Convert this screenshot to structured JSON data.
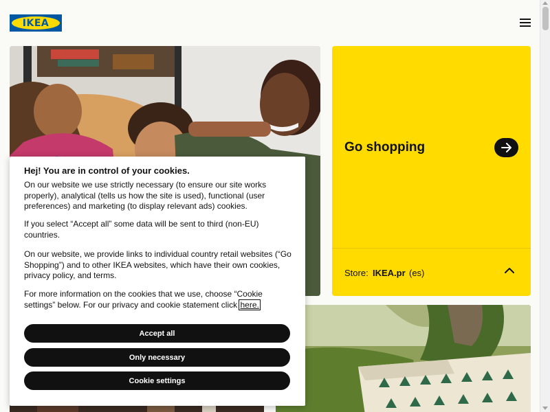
{
  "header": {
    "logo_text": "IKEA",
    "menu_icon": "hamburger-menu-icon"
  },
  "colors": {
    "brand_blue": "#0058a3",
    "brand_yellow": "#ffdb00",
    "button_black": "#111111"
  },
  "shop_card": {
    "title": "Go shopping",
    "arrow_icon": "arrow-right-icon",
    "store_prefix": "Store:",
    "store_name": "IKEA.pr",
    "store_lang": "(es)",
    "chevron_icon": "chevron-up-icon"
  },
  "cookie_dialog": {
    "title": "Hej! You are in control of your cookies.",
    "paragraph_1": "On our website we use strictly necessary (to ensure our site works properly), analytical (tells us how the site is used), functional (user preferences) and marketing (to display relevant ads) cookies.",
    "paragraph_2": "If you select “Accept all” some data will be sent to third (non-EU) countries.",
    "paragraph_3": "On our website, we provide links to individual country retail websites (“Go Shopping”) and to other IKEA websites, which have their own cookies, privacy policy, and terms.",
    "paragraph_4": "For more information on the cookies that we use, choose “Cookie settings” below. For our privacy and cookie statement click",
    "link_here": "here.",
    "buttons": {
      "accept_all": "Accept all",
      "only_necessary": "Only necessary",
      "cookie_settings": "Cookie settings"
    }
  }
}
